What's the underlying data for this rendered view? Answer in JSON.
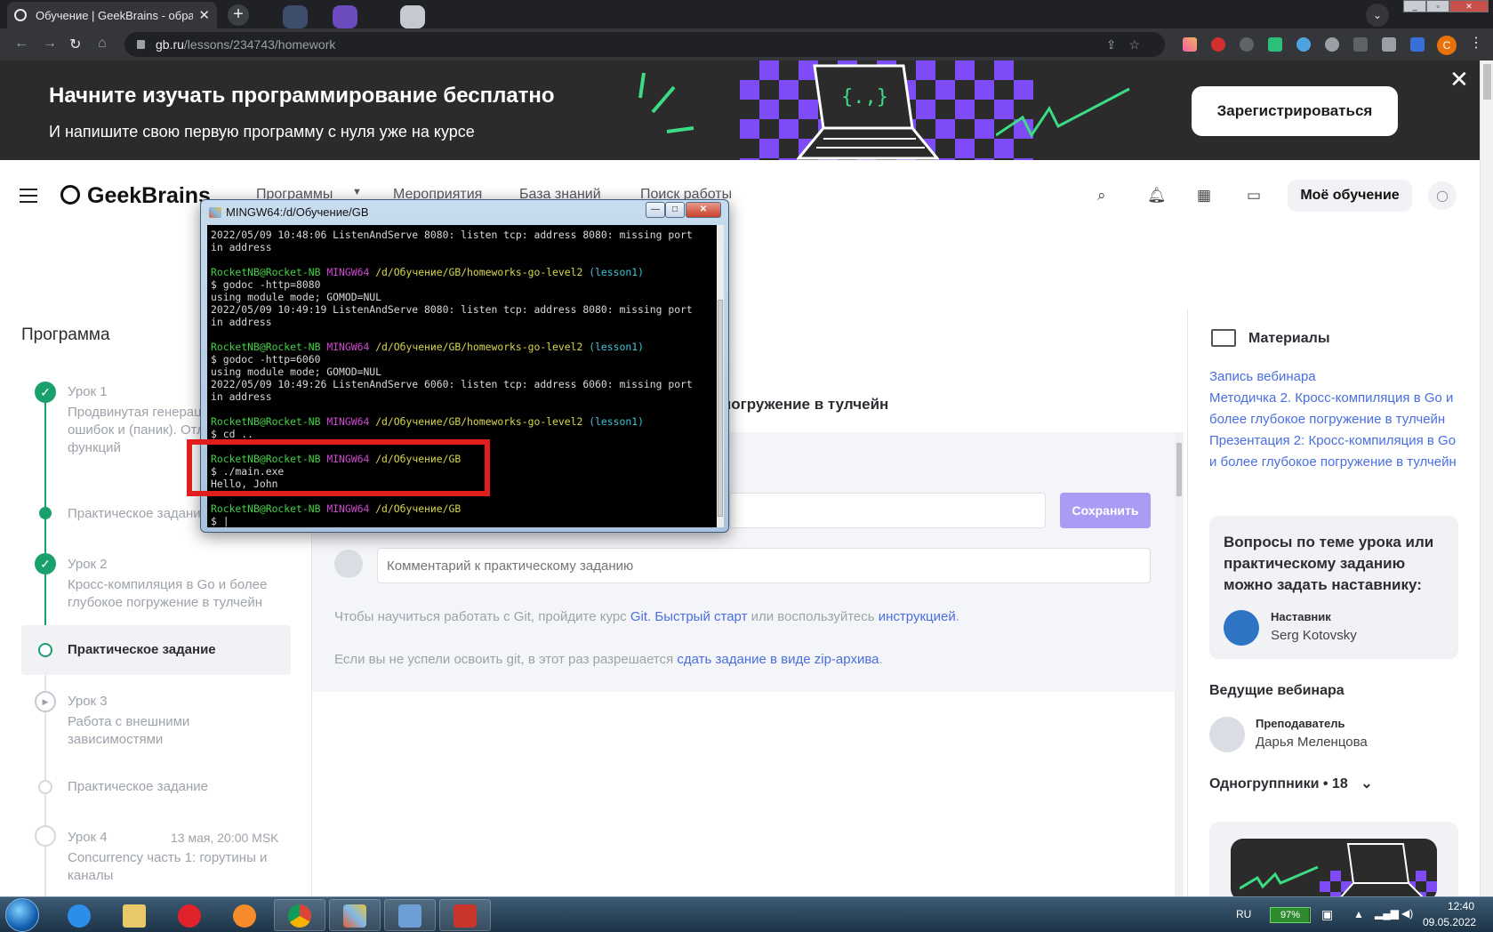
{
  "browser": {
    "tab_title": "Обучение | GeekBrains - образо",
    "url_host": "gb.ru",
    "url_path": "/lessons/234743/homework",
    "profile_initial": "C"
  },
  "banner": {
    "heading": "Начните изучать программирование бесплатно",
    "subheading": "И напишите свою первую программу с нуля уже на курсе",
    "cta": "Зарегистрироваться"
  },
  "header": {
    "logo": "GeekBrains",
    "nav": [
      "Программы",
      "Мероприятия",
      "База знаний",
      "Поиск работы"
    ],
    "my_learning": "Моё обучение"
  },
  "program": {
    "title": "Программа",
    "lesson1_title": "Урок 1",
    "lesson1_desc": "Продвинутая генерац обработка ошибок и (паник). Отложенны функций",
    "lesson1_task": "Практическое задани",
    "lesson2_title": "Урок 2",
    "lesson2_desc": "Кросс-компиляция в Go и более глубокое погружение в тулчейн",
    "lesson2_task": "Практическое задание",
    "lesson3_title": "Урок 3",
    "lesson3_desc": "Работа с внешними зависимостями",
    "lesson3_task": "Практическое задание",
    "lesson4_title": "Урок 4",
    "lesson4_date": "13 мая, 20:00 MSK",
    "lesson4_desc": "Concurrency часть 1: горутины и каналы"
  },
  "main": {
    "task_title_fragment": "погружение в тулчейн",
    "save_button": "Сохранить",
    "comment_placeholder": "Комментарий к практическому заданию",
    "git_text_1": "Чтобы научиться работать с Git, пройдите курс ",
    "git_link_1": "Git. Быстрый старт",
    "git_text_2": " или воспользуйтесь ",
    "git_link_2": "инструкцией",
    "git_text_3": ".",
    "zip_text_1": "Если вы не успели освоить git, в этот раз разрешается ",
    "zip_link": "сдать задание в виде zip-архива",
    "zip_text_2": "."
  },
  "materials": {
    "title": "Материалы",
    "links": [
      "Запись вебинара",
      "Методичка 2. Кросс-компиляция в Go и более глубокое погружение в тулчейн",
      "Презентация 2: Кросс-компиляция в Go и более глубокое погружение в тулчейн"
    ],
    "question": "Вопросы по теме урока или практическому заданию можно задать наставнику:",
    "mentor_role": "Наставник",
    "mentor_name": "Serg Kotovsky",
    "webinar_hosts_title": "Ведущие вебинара",
    "teacher_role": "Преподаватель",
    "teacher_name": "Дарья Меленцова",
    "classmates": "Одногруппники • 18"
  },
  "terminal": {
    "title": "MINGW64:/d/Обучение/GB",
    "line_err1a": "2022/05/09 10:48:06 ListenAndServe 8080: listen tcp: address 8080: missing port",
    "line_err1b": "in address",
    "prompt_user": "RocketNB@Rocket-NB",
    "prompt_sys": "MINGW64",
    "path_hw": "/d/Обучение/GB/homeworks-go-level2",
    "branch": "(lesson1)",
    "path_gb": "/d/Обучение/GB",
    "cmd1": "$ godoc -http=8080",
    "mode1": "using module mode; GOMOD=NUL",
    "line_err2a": "2022/05/09 10:49:19 ListenAndServe 8080: listen tcp: address 8080: missing port",
    "line_err2b": "in address",
    "cmd2": "$ godoc -http=6060",
    "mode2": "using module mode; GOMOD=NUL",
    "line_err3a": "2022/05/09 10:49:26 ListenAndServe 6060: listen tcp: address 6060: missing port",
    "line_err3b": "in address",
    "cmd3": "$ cd ..",
    "cmd4": "$ ./main.exe",
    "output": "Hello, John",
    "final_prompt": "$ |"
  },
  "taskbar": {
    "lang": "RU",
    "battery": "97%",
    "battery_level": 0.97,
    "time": "12:40",
    "date": "09.05.2022"
  },
  "colors": {
    "accent_green": "#1aa06d",
    "link_blue": "#4a6ee0",
    "banner_purple": "#7d4cf6",
    "highlight_red": "#e01e1e"
  }
}
